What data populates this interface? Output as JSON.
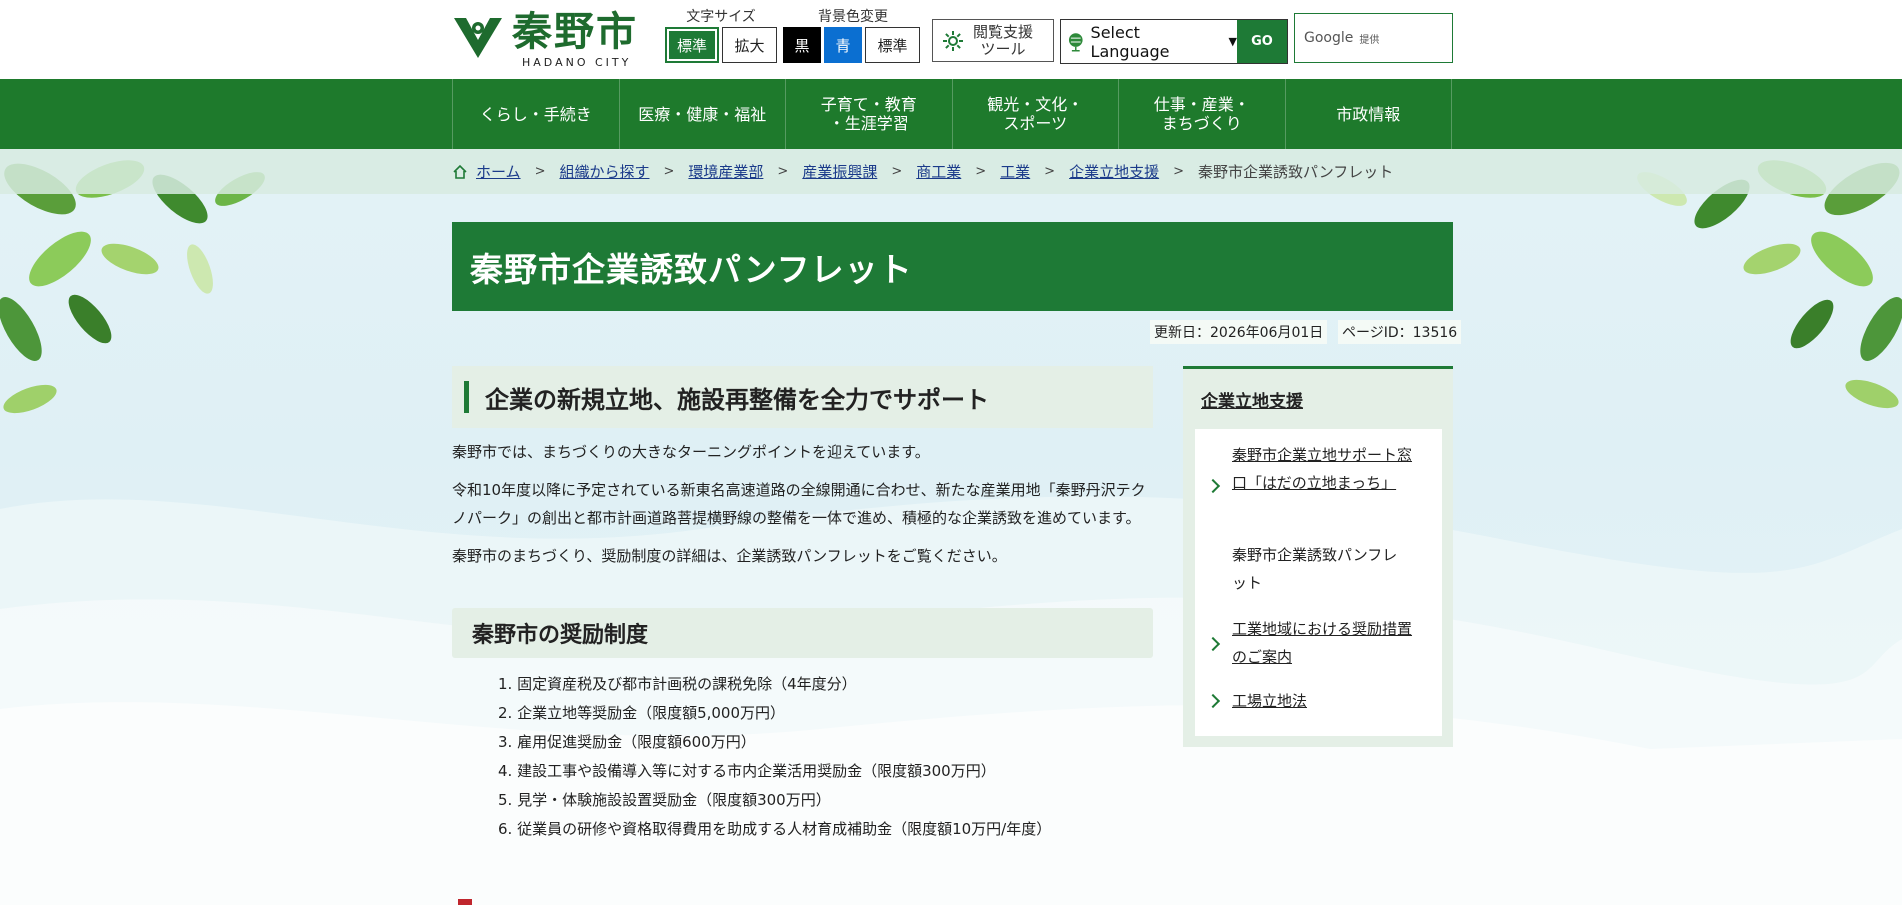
{
  "header": {
    "logo_text": "秦野市",
    "logo_sub": "HADANO CITY",
    "font_size_label": "文字サイズ",
    "font_size_options": [
      "標準",
      "拡大"
    ],
    "bg_color_label": "背景色変更",
    "bg_color_options": [
      "黒",
      "青",
      "標準"
    ],
    "tool_label_1": "閲覧支援",
    "tool_label_2": "ツール",
    "language_select": "Select Language",
    "language_go": "GO",
    "search_brand": "Google",
    "search_suffix": "提供"
  },
  "nav": {
    "items": [
      {
        "line1": "くらし・手続き",
        "line2": ""
      },
      {
        "line1": "医療・健康・福祉",
        "line2": ""
      },
      {
        "line1": "子育て・教育",
        "line2": "・生涯学習"
      },
      {
        "line1": "観光・文化・",
        "line2": "スポーツ"
      },
      {
        "line1": "仕事・産業・",
        "line2": "まちづくり"
      },
      {
        "line1": "市政情報",
        "line2": ""
      }
    ]
  },
  "breadcrumb": {
    "items": [
      "ホーム",
      "組織から探す",
      "環境産業部",
      "産業振興課",
      "商工業",
      "工業",
      "企業立地支援"
    ],
    "current": "秦野市企業誘致パンフレット"
  },
  "page": {
    "title": "秦野市企業誘致パンフレット",
    "updated": "更新日：2026年06月01日",
    "page_id": "ページID：13516"
  },
  "main": {
    "h2": "企業の新規立地、施設再整備を全力でサポート",
    "paragraphs": [
      "秦野市では、まちづくりの大きなターニングポイントを迎えています。",
      "令和10年度以降に予定されている新東名高速道路の全線開通に合わせ、新たな産業用地「秦野丹沢テクノパーク」の創出と都市計画道路菩提横野線の整備を一体で進め、積極的な企業誘致を進めています。",
      "秦野市のまちづくり、奨励制度の詳細は、企業誘致パンフレットをご覧ください。"
    ],
    "h3": "秦野市の奨励制度",
    "list": [
      "1. 固定資産税及び都市計画税の課税免除（4年度分）",
      "2. 企業立地等奨励金（限度額5,000万円）",
      "3. 雇用促進奨励金（限度額600万円）",
      "4. 建設工事や設備導入等に対する市内企業活用奨励金（限度額300万円）",
      "5. 見学・体験施設設置奨励金（限度額300万円）",
      "6. 従業員の研修や資格取得費用を助成する人材育成補助金（限度額10万円/年度）"
    ]
  },
  "side": {
    "title": "企業立地支援",
    "items": [
      "秦野市企業立地サポート窓口「はだの立地まっち」",
      "秦野市企業誘致パンフレット",
      "工業地域における奨励措置のご案内",
      "工場立地法"
    ]
  },
  "colors": {
    "brand_green": "#1e7a36",
    "nav_green": "#1e7a2c",
    "link_blue": "#1a3a8a",
    "bg_blue_button": "#0b6fd1"
  }
}
